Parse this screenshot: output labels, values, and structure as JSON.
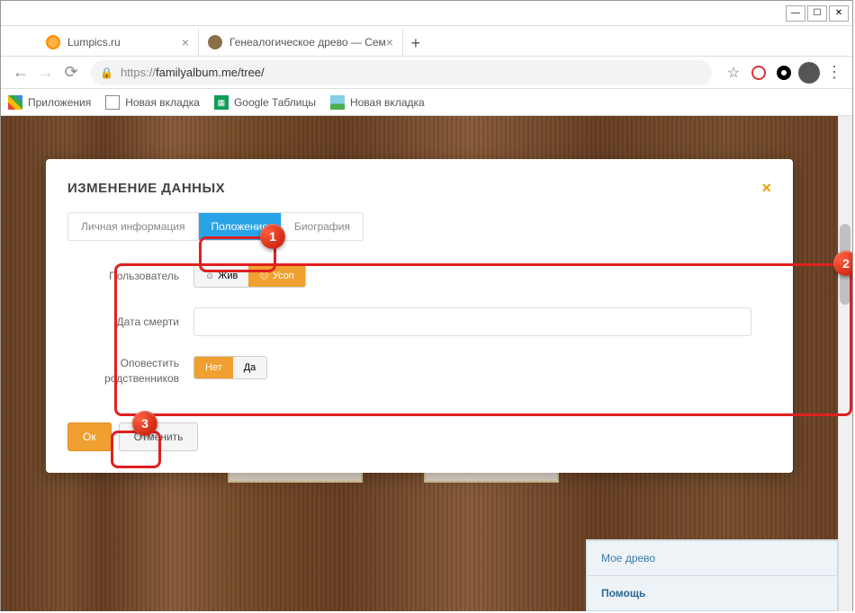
{
  "window": {
    "tabs": [
      {
        "title": "Lumpics.ru"
      },
      {
        "title": "Генеалогическое древо — Сем"
      }
    ],
    "url_prefix": "https://",
    "url_rest": "familyalbum.me/tree/"
  },
  "bookmarks": {
    "apps": "Приложения",
    "newtab1": "Новая вкладка",
    "sheets": "Google Таблицы",
    "newtab2": "Новая вкладка"
  },
  "modal": {
    "title": "ИЗМЕНЕНИЕ ДАННЫХ",
    "tabs": {
      "personal": "Личная информация",
      "position": "Положение",
      "bio": "Биография"
    },
    "form": {
      "user_label": "Пользователь",
      "alive": "Жив",
      "deceased": "Усоп",
      "death_date_label": "Дата смерти",
      "death_date_value": "",
      "notify_label": "Оповестить родственников",
      "no": "Нет",
      "yes": "Да"
    },
    "actions": {
      "ok": "Ок",
      "cancel": "Отменить"
    }
  },
  "sidebar": {
    "my_tree": "Мое древо",
    "help": "Помощь"
  },
  "annotations": {
    "a1": "1",
    "a2": "2",
    "a3": "3"
  }
}
